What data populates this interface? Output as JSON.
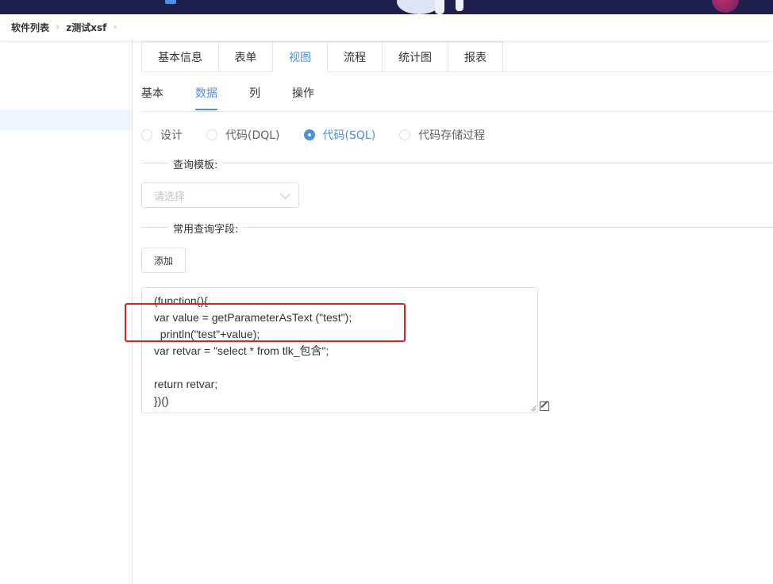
{
  "breadcrumb": {
    "items": [
      "软件列表",
      "z测试xsf"
    ]
  },
  "tabs_primary": [
    {
      "label": "基本信息",
      "active": false
    },
    {
      "label": "表单",
      "active": false
    },
    {
      "label": "视图",
      "active": true
    },
    {
      "label": "流程",
      "active": false
    },
    {
      "label": "统计图",
      "active": false
    },
    {
      "label": "报表",
      "active": false
    }
  ],
  "tabs_secondary": [
    {
      "label": "基本",
      "active": false
    },
    {
      "label": "数据",
      "active": true
    },
    {
      "label": "列",
      "active": false
    },
    {
      "label": "操作",
      "active": false
    }
  ],
  "mode_options": [
    {
      "label": "设计",
      "checked": false
    },
    {
      "label": "代码(DQL)",
      "checked": false
    },
    {
      "label": "代码(SQL)",
      "checked": true
    },
    {
      "label": "代码存储过程",
      "checked": false
    }
  ],
  "query_template": {
    "label": "查询模板:",
    "placeholder": "请选择"
  },
  "common_fields": {
    "label": "常用查询字段:",
    "add_button": "添加"
  },
  "code_lines": [
    "(function(){",
    "var value = getParameterAsText (\"test\");",
    "  println(\"test\"+value);",
    "var retvar = \"select * from tlk_包含\";",
    "",
    "return retvar;",
    "})()"
  ],
  "colors": {
    "accent": "#4a90e2",
    "highlight": "#e02020",
    "topbar": "#1f1f4d"
  }
}
